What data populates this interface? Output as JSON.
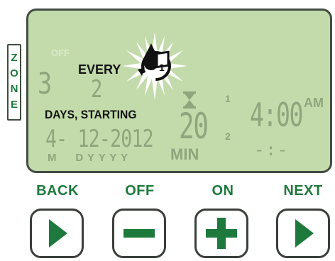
{
  "zone_label_letters": [
    "Z",
    "O",
    "N",
    "E"
  ],
  "lcd": {
    "off": "OFF",
    "zone_number": "3",
    "every_label": "EVERY",
    "interval_number": "2",
    "days_starting_label": "DAYS, STARTING",
    "date_value": "4- 12-2012",
    "date_format": "M     D Y Y Y Y",
    "run_time": "20",
    "run_unit": "MIN",
    "program_1_label": "1",
    "program_2_label": "2",
    "start_time_1": "4:00",
    "am_label": "AM",
    "start_time_2": "-:-",
    "calendar_icon_number": "1"
  },
  "buttons": {
    "back": "BACK",
    "off": "OFF",
    "on": "ON",
    "next": "NEXT"
  },
  "colors": {
    "lcd_background": "#c3dbab",
    "lcd_dim_segment": "#8ea57d",
    "brand_green": "#1e7a3c",
    "bezel": "#434b43"
  }
}
